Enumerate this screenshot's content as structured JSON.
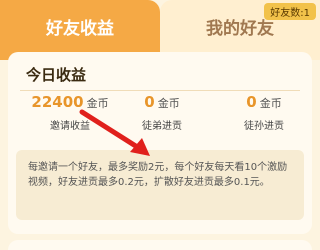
{
  "tabs": {
    "active": "好友收益",
    "inactive": "我的好友",
    "friend_count_badge": "好友数:1"
  },
  "today": {
    "title": "今日收益",
    "stats": [
      {
        "value": "22400",
        "unit": "金币",
        "label": "邀请收益"
      },
      {
        "value": "0",
        "unit": "金币",
        "label": "徒弟进贡"
      },
      {
        "value": "0",
        "unit": "金币",
        "label": "徒孙进贡"
      }
    ]
  },
  "note": "每邀请一个好友，最多奖励2元，每个好友每天看10个激励视频，好友进贡最多0.2元，扩散好友进贡最多0.1元。",
  "colors": {
    "accent": "#f5a945",
    "value": "#e8952a",
    "arrow": "#e0201c"
  }
}
